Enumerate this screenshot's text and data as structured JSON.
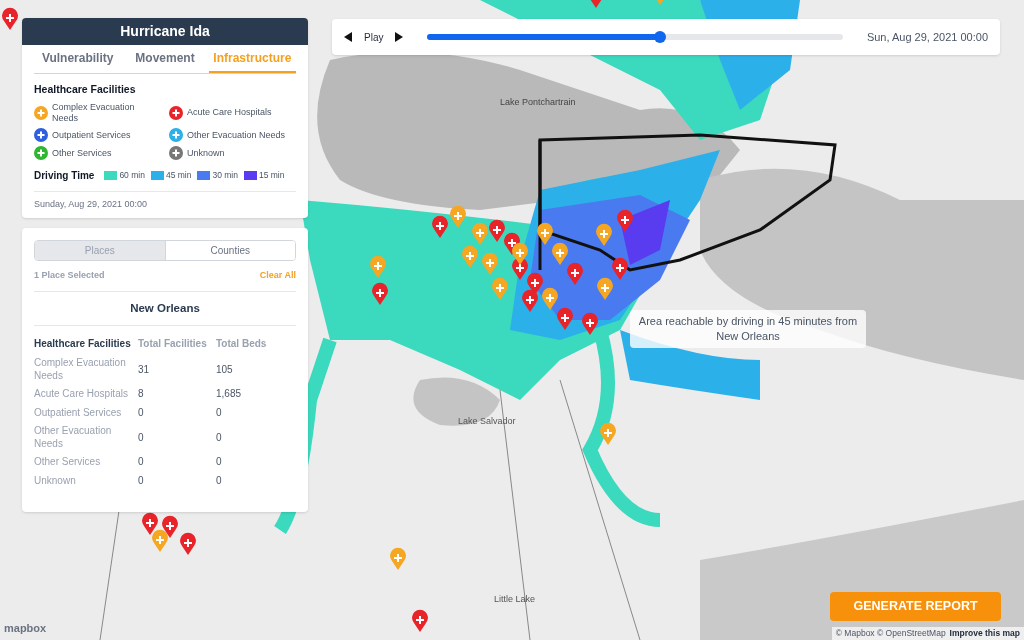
{
  "panel": {
    "title": "Hurricane Ida",
    "tabs": [
      {
        "label": "Vulnerability",
        "selected": false
      },
      {
        "label": "Movement",
        "selected": false
      },
      {
        "label": "Infrastructure",
        "selected": true
      }
    ],
    "legend_title": "Healthcare Facilities",
    "legend": [
      {
        "label": "Complex Evacuation Needs",
        "color": "#f5a623"
      },
      {
        "label": "Acute Care Hospitals",
        "color": "#e8232a"
      },
      {
        "label": "Outpatient Services",
        "color": "#2f5fe0"
      },
      {
        "label": "Other Evacuation Needs",
        "color": "#2bb0ea"
      },
      {
        "label": "Other Services",
        "color": "#2fb52f"
      },
      {
        "label": "Unknown",
        "color": "#777777"
      }
    ],
    "driving_title": "Driving Time",
    "driving": [
      {
        "label": "60 min",
        "color": "#3bd9be"
      },
      {
        "label": "45 min",
        "color": "#2cb0ea"
      },
      {
        "label": "30 min",
        "color": "#4a7af0"
      },
      {
        "label": "15 min",
        "color": "#5a3cf0"
      }
    ],
    "date": "Sunday, Aug 29, 2021 00:00"
  },
  "details": {
    "toggle": [
      {
        "label": "Places",
        "selected": true
      },
      {
        "label": "Counties",
        "selected": false
      }
    ],
    "selected_count": "1 Place Selected",
    "clear": "Clear All",
    "place": "New Orleans",
    "columns": [
      "Healthcare Facilities",
      "Total Facilities",
      "Total Beds"
    ],
    "rows": [
      [
        "Complex Evacuation Needs",
        "31",
        "105"
      ],
      [
        "Acute Care Hospitals",
        "8",
        "1,685"
      ],
      [
        "Outpatient Services",
        "0",
        "0"
      ],
      [
        "Other Evacuation Needs",
        "0",
        "0"
      ],
      [
        "Other Services",
        "0",
        "0"
      ],
      [
        "Unknown",
        "0",
        "0"
      ]
    ]
  },
  "player": {
    "play": "Play",
    "level": 0.56,
    "date": "Sun, Aug 29, 2021 00:00"
  },
  "tooltip": "Area reachable by driving in 45 minutes from New Orleans",
  "map_labels": [
    {
      "text": "Lake Pontchartrain"
    },
    {
      "text": "Lake Salvador"
    },
    {
      "text": "Little Lake"
    }
  ],
  "report_button": "GENERATE REPORT",
  "attribution": {
    "logo": "mapbox",
    "credits": "© Mapbox © OpenStreetMap",
    "improve": "Improve this map"
  }
}
